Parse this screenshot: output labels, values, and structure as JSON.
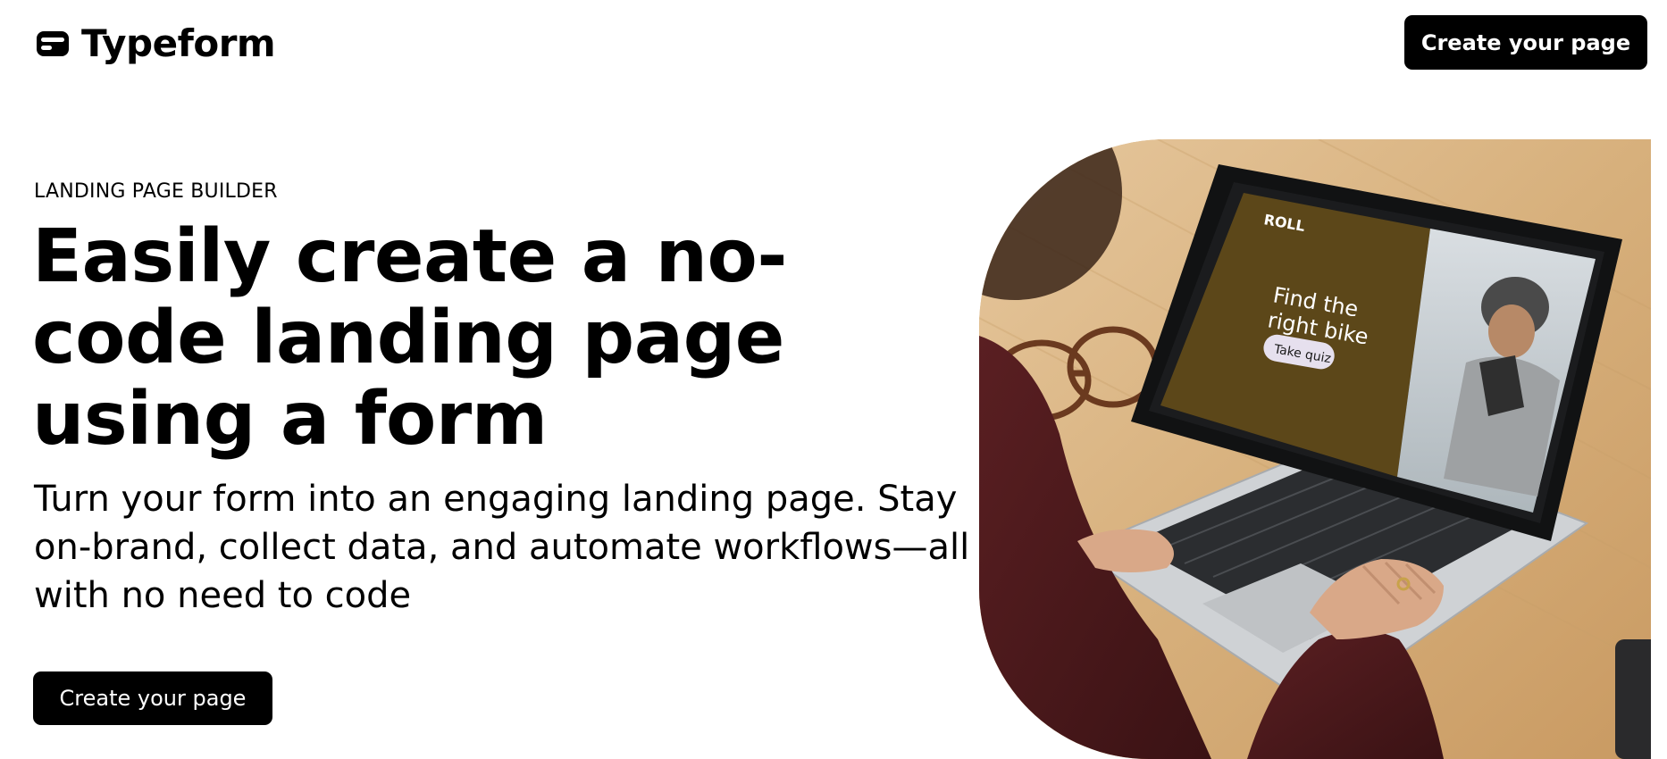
{
  "header": {
    "logo_text": "Typeform",
    "logo_icon": "typeform-logo-icon",
    "cta_label": "Create your page"
  },
  "hero": {
    "eyebrow": "LANDING PAGE BUILDER",
    "title": "Easily create a no-code landing page using a form",
    "subtitle": "Turn your form into an engaging landing page. Stay on-brand, collect data, and automate workflows—all with no need to code",
    "cta_label": "Create your page"
  },
  "hero_image": {
    "screen_brand": "ROLL",
    "screen_headline_line1": "Find the",
    "screen_headline_line2": "right bike",
    "screen_button": "Take quiz"
  },
  "colors": {
    "background": "#ffffff",
    "text": "#000000",
    "button_bg": "#000000",
    "button_text": "#ffffff",
    "screen_panel": "#5c4719"
  }
}
